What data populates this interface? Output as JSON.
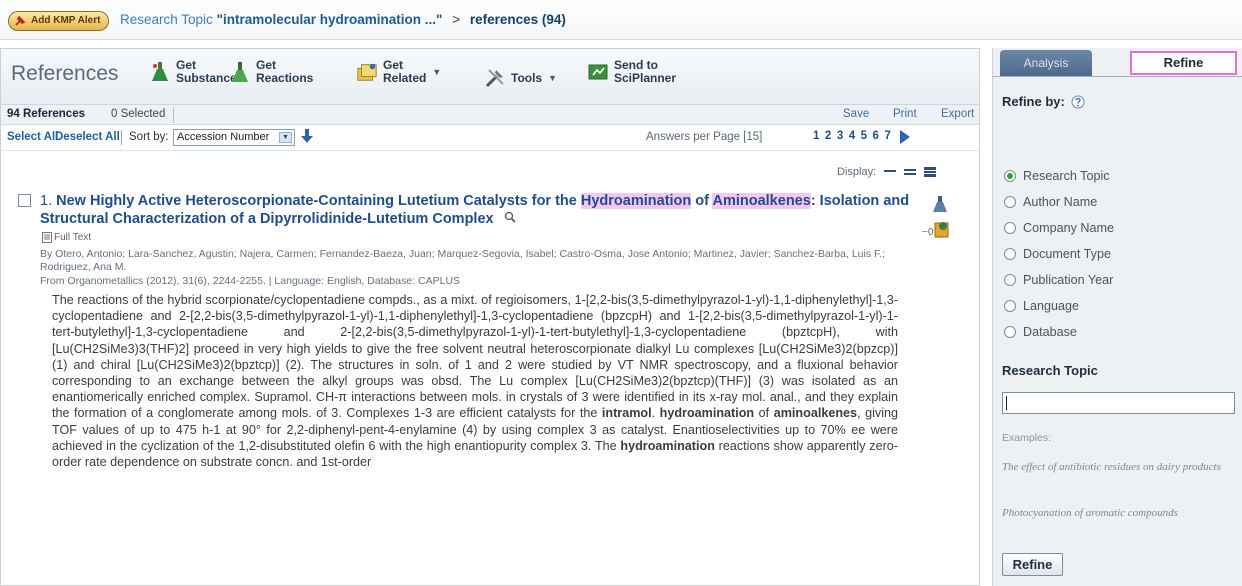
{
  "breadcrumb": {
    "kmp_button": "Add KMP Alert",
    "research_topic_label": "Research Topic",
    "topic_query": "\"intramolecular hydroamination ...\"",
    "separator": ">",
    "current": "references (94)"
  },
  "toolbar": {
    "title": "References",
    "get_substances": [
      "Get",
      "Substances"
    ],
    "get_reactions": [
      "Get",
      "Reactions"
    ],
    "get_related": [
      "Get",
      "Related"
    ],
    "tools": "Tools",
    "send_to": [
      "Send to",
      "SciPlanner"
    ]
  },
  "countbar": {
    "count": "94 References",
    "selected": "0 Selected",
    "save": "Save",
    "print": "Print",
    "export": "Export"
  },
  "sortbar": {
    "select_all": "Select All",
    "deselect_all": "Deselect All",
    "sort_by": "Sort by:",
    "sort_value": "Accession Number",
    "answers_per_page": "Answers per Page [15]",
    "pages": [
      "1",
      "2",
      "3",
      "4",
      "5",
      "6",
      "7"
    ]
  },
  "display": {
    "label": "Display:"
  },
  "result": {
    "number": "1.",
    "title_part1": "New Highly Active Heteroscorpionate-Containing Lutetium Catalysts for the ",
    "title_hl1": "Hydroamination",
    "title_part2": " of ",
    "title_hl2": "Aminoalkenes",
    "title_part3": ": Isolation and Structural Characterization of a Dipyrrolidinide-Lutetium Complex",
    "full_text": "Full Text",
    "authors": "By Otero, Antonio; Lara-Sanchez, Agustin; Najera, Carmen; Fernandez-Baeza, Juan; Marquez-Segovia, Isabel; Castro-Osma, Jose Antonio; Martinez, Javier; Sanchez-Barba, Luis F.; Rodriguez, Ana M.",
    "source": "From Organometallics (2012), 31(6), 2244-2255.  |  Language: English, Database: CAPLUS",
    "cited_count": "~0",
    "abstract_1": "The reactions of the hybrid scorpionate/cyclopentadiene compds., as a mixt. of regioisomers, 1-[2,2-bis(3,5-dimethylpyrazol-1-yl)-1,1-diphenylethyl]-1,3-cyclopentadiene and 2-[2,2-bis(3,5-dimethylpyrazol-1-yl)-1,1-diphenylethyl]-1,3-cyclopentadiene (bpzcpH) and 1-[2,2-bis(3,5-dimethylpyrazol-1-yl)-1-tert-butylethyl]-1,3-cyclopentadiene and 2-[2,2-bis(3,5-dimethylpyrazol-1-yl)-1-tert-butylethyl]-1,3-cyclopentadiene (bpztcpH), with [Lu(CH2SiMe3)3(THF)2] proceed in very high yields to give the free solvent neutral heteroscorpionate dialkyl Lu complexes [Lu(CH2SiMe3)2(bpzcp)] (1) and chiral [Lu(CH2SiMe3)2(bpztcp)] (2). The structures in soln. of 1 and 2 were studied by VT NMR spectroscopy, and a fluxional behavior corresponding to an exchange between the alkyl groups was obsd. The Lu complex [Lu(CH2SiMe3)2(bpztcp)(THF)] (3) was isolated as an enantiomerically enriched complex. Supramol. CH-π interactions between mols. in crystals of 3 were identified in its x-ray mol. anal., and they explain the formation of a conglomerate among mols. of 3. Complexes 1-3 are efficient catalysts for the ",
    "abstract_b1": "intramol",
    "abstract_2": ". ",
    "abstract_b2": "hydroamination",
    "abstract_3": " of ",
    "abstract_b3": "aminoalkenes",
    "abstract_4": ", giving TOF values of up to 475 h-1 at 90° for 2,2-diphenyl-pent-4-enylamine (4) by using complex 3 as catalyst. Enantioselectivities up to 70% ee were achieved in the cyclization of the 1,2-disubstituted olefin 6 with the high enantiopurity complex 3. The ",
    "abstract_b4": "hydroamination",
    "abstract_5": " reactions show apparently zero-order rate dependence on substrate concn. and 1st-order"
  },
  "right_panel": {
    "tab_analysis": "Analysis",
    "tab_refine": "Refine",
    "refine_by": "Refine by:",
    "options": [
      "Research Topic",
      "Author Name",
      "Company Name",
      "Document Type",
      "Publication Year",
      "Language",
      "Database"
    ],
    "selected_option": "Research Topic",
    "research_topic_title": "Research Topic",
    "research_topic_value": "",
    "examples_label": "Examples:",
    "example_1": "The effect of antibiotic residues on dairy products",
    "example_2": "Photocyanation of aromatic compounds",
    "refine_button": "Refine"
  },
  "colors": {
    "link": "#1f4d8c",
    "highlight": "#f5c6f0",
    "active_tab_border": "#e86fd9",
    "radio_selected": "#3a9b47"
  },
  "icons": [
    "pin-icon",
    "flask-icon",
    "reaction-flask-icon",
    "related-stack-icon",
    "tools-icon",
    "sciplanner-icon",
    "sort-down-arrow-icon",
    "next-page-icon",
    "display-list-icon",
    "magnifier-icon",
    "full-text-icon",
    "help-icon",
    "cited-icon"
  ]
}
